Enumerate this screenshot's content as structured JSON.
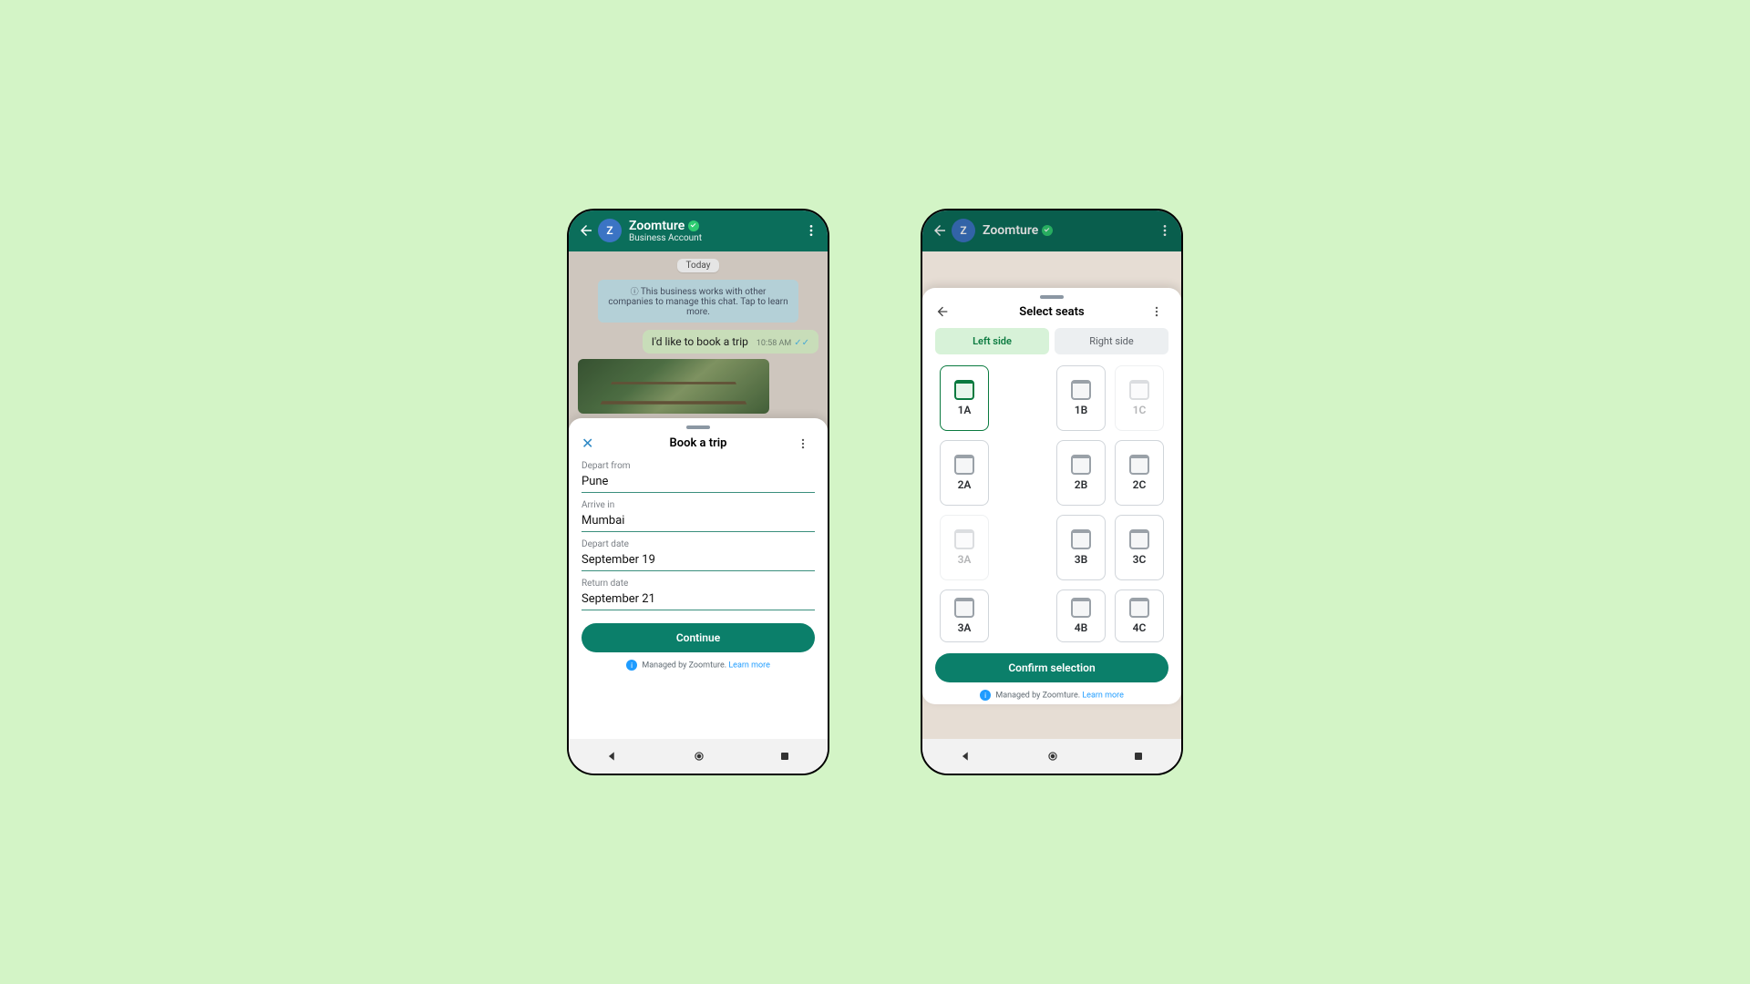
{
  "phone1": {
    "header": {
      "name": "Zoomture",
      "sub": "Business Account",
      "avatar_letter": "Z"
    },
    "day": "Today",
    "info": "This business works with other companies to manage this chat. Tap to learn more.",
    "message": {
      "text": "I'd like to book a trip",
      "time": "10:58 AM"
    },
    "sheet": {
      "title": "Book a trip",
      "depart_from_label": "Depart from",
      "depart_from": "Pune",
      "arrive_in_label": "Arrive in",
      "arrive_in": "Mumbai",
      "depart_date_label": "Depart date",
      "depart_date": "September 19",
      "return_date_label": "Return date",
      "return_date": "September 21",
      "cta": "Continue",
      "managed": "Managed by Zoomture.",
      "learn_more": "Learn more"
    }
  },
  "phone2": {
    "header": {
      "name": "Zoomture",
      "avatar_letter": "Z"
    },
    "sheet": {
      "title": "Select seats",
      "tab_left": "Left side",
      "tab_right": "Right side",
      "seats": {
        "s1a": "1A",
        "s1b": "1B",
        "s1c": "1C",
        "s2a": "2A",
        "s2b": "2B",
        "s2c": "2C",
        "s3a": "3A",
        "s3b": "3B",
        "s3c": "3C",
        "s4a": "3A",
        "s4b": "4B",
        "s4c": "4C"
      },
      "cta": "Confirm selection",
      "managed": "Managed by Zoomture.",
      "learn_more": "Learn more"
    }
  }
}
